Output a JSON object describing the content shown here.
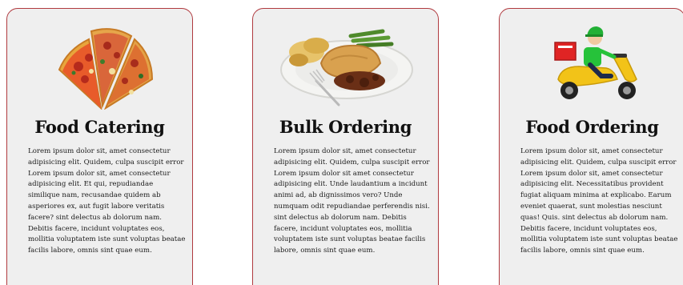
{
  "cards": [
    {
      "title": "Food Catering",
      "icon": "pizza-slices-image",
      "text": "Lorem ipsum dolor sit, amet consectetur adipisicing elit. Quidem, culpa suscipit error Lorem ipsum dolor sit, amet consectetur adipisicing elit. Et qui, repudiandae similique nam, recusandae quidem ab asperiores ex, aut fugit labore veritatis facere? sint delectus ab dolorum nam. Debitis facere, incidunt voluptates eos, mollitia voluptatem iste sunt voluptas beatae facilis labore, omnis sint quae eum."
    },
    {
      "title": "Bulk Ordering",
      "icon": "meal-plate-image",
      "text": "Lorem ipsum dolor sit, amet consectetur adipisicing elit. Quidem, culpa suscipit error Lorem ipsum dolor sit amet consectetur adipisicing elit. Unde laudantium a incidunt animi ad, ab dignissimos vero? Unde numquam odit repudiandae perferendis nisi. sint delectus ab dolorum nam. Debitis facere, incidunt voluptates eos, mollitia voluptatem iste sunt voluptas beatae facilis labore, omnis sint quae eum."
    },
    {
      "title": "Food Ordering",
      "icon": "delivery-scooter-image",
      "text": "Lorem ipsum dolor sit, amet consectetur adipisicing elit. Quidem, culpa suscipit error Lorem ipsum dolor sit, amet consectetur adipisicing elit. Necessitatibus provident fugiat aliquam minima at explicabo. Earum eveniet quaerat, sunt molestias nesciunt quas! Quis. sint delectus ab dolorum nam. Debitis facere, incidunt voluptates eos, mollitia voluptatem iste sunt voluptas beatae facilis labore, omnis sint quae eum."
    }
  ],
  "colors": {
    "card_border": "#b03a3f",
    "card_background": "#efefef",
    "title_text": "#111111",
    "body_text": "#1a1a1a"
  }
}
